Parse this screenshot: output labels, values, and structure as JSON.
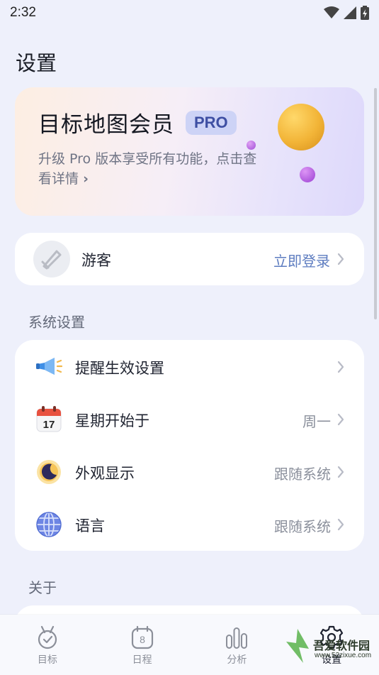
{
  "status_bar": {
    "time": "2:32"
  },
  "page": {
    "title": "设置"
  },
  "pro_card": {
    "title": "目标地图会员",
    "badge": "PRO",
    "description": "升级 Pro 版本享受所有功能，点击查看详情",
    "chevron": "›"
  },
  "guest": {
    "name": "游客",
    "action": "立即登录"
  },
  "system_section": {
    "label": "系统设置",
    "items": [
      {
        "label": "提醒生效设置",
        "value": "",
        "icon": "megaphone-icon"
      },
      {
        "label": "星期开始于",
        "value": "周一",
        "icon": "calendar-icon",
        "icon_text": "17"
      },
      {
        "label": "外观显示",
        "value": "跟随系统",
        "icon": "moon-icon"
      },
      {
        "label": "语言",
        "value": "跟随系统",
        "icon": "globe-icon"
      }
    ]
  },
  "about_section": {
    "label": "关于"
  },
  "tab_bar": {
    "tabs": [
      {
        "label": "目标",
        "icon": "target-medal-icon"
      },
      {
        "label": "日程",
        "icon": "calendar-8-icon",
        "icon_text": "8"
      },
      {
        "label": "分析",
        "icon": "bar-chart-icon"
      },
      {
        "label": "设置",
        "icon": "gear-icon",
        "active": true
      }
    ]
  },
  "watermark": {
    "text": "吾爱软件园",
    "url": "www.52zixue.com"
  },
  "colors": {
    "accent": "#5d7cc0",
    "background": "#eef0fb",
    "badge": "#cdd3f6"
  }
}
